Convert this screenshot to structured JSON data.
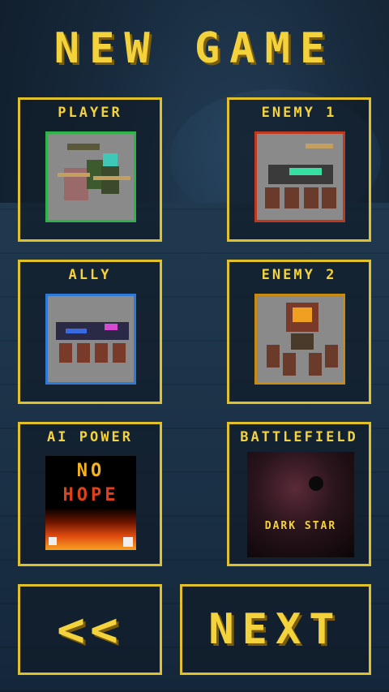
{
  "title": "NEW GAME",
  "cards": {
    "player": {
      "label": "PLAYER",
      "border_color": "#2fb44a"
    },
    "enemy1": {
      "label": "ENEMY 1",
      "border_color": "#c0391f"
    },
    "ally": {
      "label": "ALLY",
      "border_color": "#2f7ad6"
    },
    "enemy2": {
      "label": "ENEMY 2",
      "border_color": "#c98a12"
    },
    "ai_power": {
      "label": "AI POWER",
      "line1": "NO",
      "line2": "HOPE"
    },
    "battlefield": {
      "label": "BATTLEFIELD",
      "map_name": "DARK STAR"
    }
  },
  "nav": {
    "back_label": "<<",
    "next_label": "NEXT"
  },
  "colors": {
    "accent": "#f4d23c",
    "panel_border": "#e0c12a"
  }
}
